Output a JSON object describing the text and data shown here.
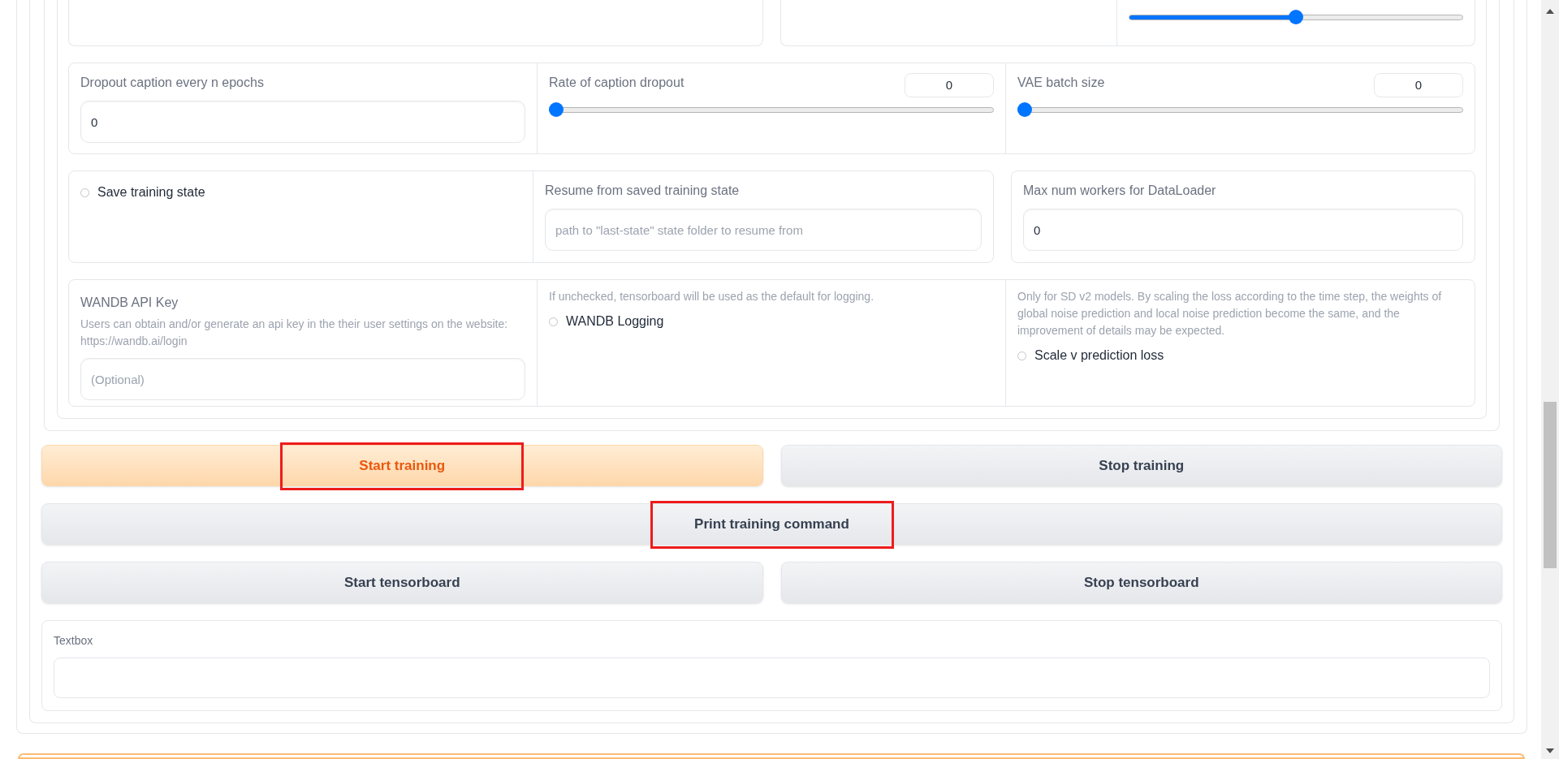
{
  "top_slider": {
    "level": 0.5
  },
  "row_1": [
    {
      "kind": "text",
      "label": "Dropout caption every n epochs",
      "value": "0"
    },
    {
      "kind": "slider",
      "label": "Rate of caption dropout",
      "value": "0",
      "level": 0
    },
    {
      "kind": "slider",
      "label": "VAE batch size",
      "value": "0",
      "level": 0
    }
  ],
  "row_2": {
    "save_state": {
      "label": "Save training state",
      "checked": false
    },
    "resume": {
      "label": "Resume from saved training state",
      "placeholder": "path to \"last-state\" state folder to resume from"
    },
    "workers": {
      "label": "Max num workers for DataLoader",
      "value": "0"
    }
  },
  "row_3": [
    {
      "kind": "text",
      "label": "WANDB API Key",
      "info": "Users can obtain and/or generate an api key in the their user settings on the website: https://wandb.ai/login",
      "placeholder": "(Optional)"
    },
    {
      "kind": "checkbox",
      "info": "If unchecked, tensorboard will be used as the default for logging.",
      "label": "WANDB Logging",
      "checked": false
    },
    {
      "kind": "checkbox",
      "info": "Only for SD v2 models. By scaling the loss according to the time step, the weights of global noise prediction and local noise prediction become the same, and the improvement of details may be expected.",
      "label": "Scale v prediction loss",
      "checked": false
    }
  ],
  "buttons": [
    [
      {
        "label": "Start training",
        "primary": true,
        "highlighted": true
      },
      {
        "label": "Stop training",
        "primary": false,
        "highlighted": false
      }
    ],
    [
      {
        "label": "Print training command",
        "primary": false,
        "highlighted": true
      }
    ],
    [
      {
        "label": "Start tensorboard",
        "primary": false,
        "highlighted": false
      },
      {
        "label": "Stop tensorboard",
        "primary": false,
        "highlighted": false
      }
    ]
  ],
  "textbox": {
    "label": "Textbox"
  }
}
